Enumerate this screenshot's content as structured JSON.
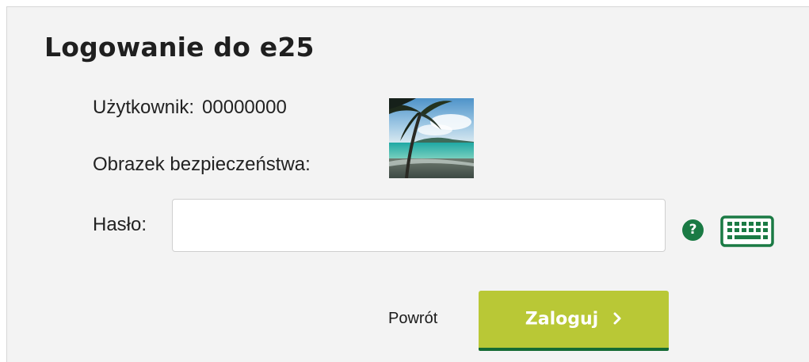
{
  "title": "Logowanie do e25",
  "user": {
    "label": "Użytkownik:",
    "value": "00000000"
  },
  "security_image": {
    "label": "Obrazek bezpieczeństwa:",
    "icon": "beach-palm-image"
  },
  "password": {
    "label": "Hasło:",
    "value": "",
    "placeholder": ""
  },
  "icons": {
    "help": "?",
    "keyboard": "keyboard-icon"
  },
  "actions": {
    "back_label": "Powrót",
    "login_label": "Zaloguj",
    "login_icon": "chevron-right-icon"
  },
  "colors": {
    "accent_green": "#1a7a44",
    "button_lime": "#b9c836",
    "button_border": "#156b34",
    "panel_bg": "#f3f3f3"
  }
}
